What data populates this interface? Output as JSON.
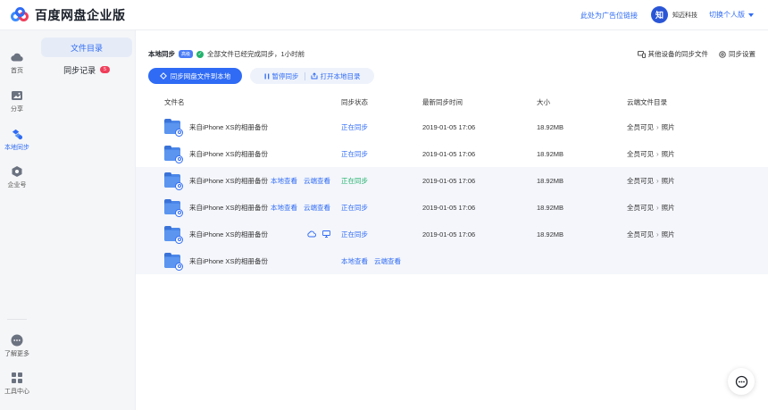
{
  "header": {
    "logo_text": "百度网盘企业版",
    "ad_link": "此处为广告位链接",
    "avatar_text": "知",
    "company": "知迈科技",
    "switch_label": "切换个人版"
  },
  "rail": {
    "items": [
      {
        "label": "首页",
        "icon": "cloud-icon"
      },
      {
        "label": "分享",
        "icon": "share-icon"
      },
      {
        "label": "本地同步",
        "icon": "sync-icon"
      },
      {
        "label": "企业号",
        "icon": "enterprise-icon"
      },
      {
        "label": "了解更多",
        "icon": "more-icon"
      },
      {
        "label": "工具中心",
        "icon": "apps-icon"
      }
    ]
  },
  "subnav": {
    "items": [
      {
        "label": "文件目录"
      },
      {
        "label": "同步记录",
        "badge": "5"
      }
    ]
  },
  "main": {
    "sync_title": "本地同步",
    "sync_tag": "高级",
    "sync_status": "全部文件已经完成同步，1小时前",
    "other_devices": "其他设备的同步文件",
    "sync_settings": "同步设置",
    "primary_button": "同步网盘文件到本地",
    "pause_button": "暂停同步",
    "open_dir_button": "打开本地目录"
  },
  "table": {
    "headers": {
      "name": "文件名",
      "status": "同步状态",
      "time": "最新同步时间",
      "size": "大小",
      "dir": "云端文件目录"
    },
    "ops_labels": {
      "local": "本地查看",
      "cloud": "云端查看"
    },
    "rows": [
      {
        "name": "来自iPhone XS的相册备份",
        "status": "正在同步",
        "time": "2019-01-05 17:06",
        "size": "18.92MB",
        "dir_root": "全员可见",
        "dir_leaf": "照片"
      },
      {
        "name": "来自iPhone XS的相册备份",
        "status": "正在同步",
        "time": "2019-01-05 17:06",
        "size": "18.92MB",
        "dir_root": "全员可见",
        "dir_leaf": "照片"
      },
      {
        "name": "来自iPhone XS的相册备份",
        "status": "正在同步",
        "time": "2019-01-05 17:06",
        "size": "18.92MB",
        "dir_root": "全员可见",
        "dir_leaf": "照片"
      },
      {
        "name": "来自iPhone XS的相册备份",
        "status": "正在同步",
        "time": "2019-01-05 17:06",
        "size": "18.92MB",
        "dir_root": "全员可见",
        "dir_leaf": "照片"
      },
      {
        "name": "来自iPhone XS的相册备份",
        "status": "正在同步",
        "time": "2019-01-05 17:06",
        "size": "18.92MB",
        "dir_root": "全员可见",
        "dir_leaf": "照片"
      },
      {
        "name": "来自iPhone XS的相册备份"
      }
    ]
  },
  "colors": {
    "accent": "#2f6bf5",
    "success": "#23b26d",
    "badge": "#f03e5a"
  }
}
